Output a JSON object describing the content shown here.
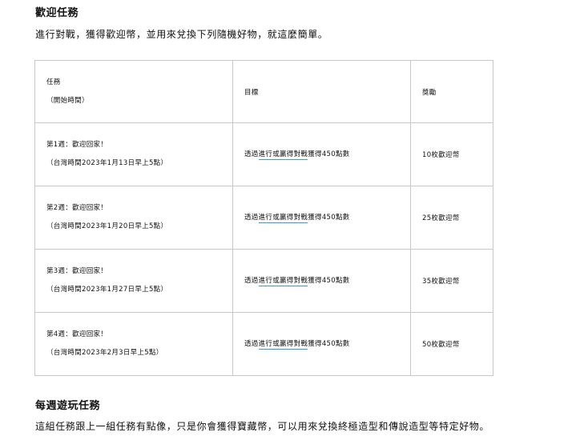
{
  "welcome": {
    "title": "歡迎任務",
    "intro": "進行對戰，獲得歡迎幣，並用來兌換下列隨機好物，就這麼簡單。"
  },
  "table": {
    "headers": {
      "task": "任務",
      "task_sub": "（開始時間）",
      "objective": "目標",
      "reward": "獎勵"
    },
    "rows": [
      {
        "week": "第1週：歡迎回家！",
        "start": "（台灣時間2023年1月13日早上5點）",
        "objective_pre": "透過",
        "objective_link": "進行或贏得對戰",
        "objective_post": "獲得450點數",
        "reward": "10枚歡迎幣"
      },
      {
        "week": "第2週：歡迎回家！",
        "start": "（台灣時間2023年1月20日早上5點）",
        "objective_pre": "透過",
        "objective_link": "進行或贏得對戰",
        "objective_post": "獲得450點數",
        "reward": "25枚歡迎幣"
      },
      {
        "week": "第3週：歡迎回家！",
        "start": "（台灣時間2023年1月27日早上5點）",
        "objective_pre": "透過",
        "objective_link": "進行或贏得對戰",
        "objective_post": "獲得450點數",
        "reward": "35枚歡迎幣"
      },
      {
        "week": "第4週：歡迎回家！",
        "start": "（台灣時間2023年2月3日早上5點）",
        "objective_pre": "透過",
        "objective_link": "進行或贏得對戰",
        "objective_post": "獲得450點數",
        "reward": "50枚歡迎幣"
      }
    ]
  },
  "weekly": {
    "title": "每週遊玩任務",
    "intro": "這組任務跟上一組任務有點像，只是你會獲得寶藏幣，可以用來兌換終極造型和傳說造型等特定好物。"
  }
}
